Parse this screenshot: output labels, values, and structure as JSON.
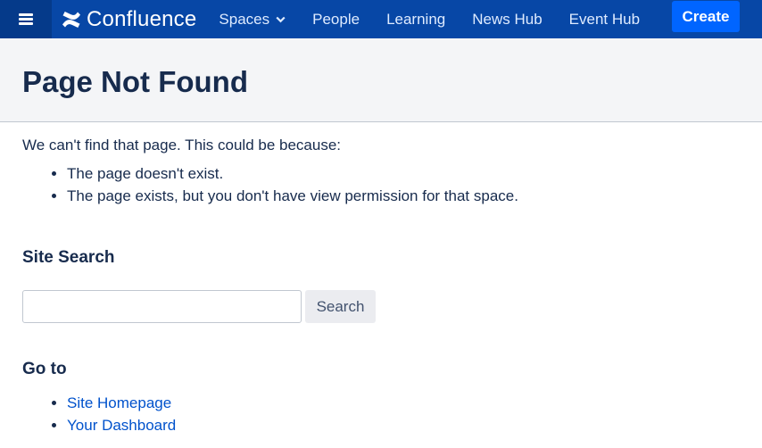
{
  "topbar": {
    "logo_text": "Confluence",
    "nav_items": [
      {
        "label": "Spaces",
        "has_dropdown": true
      },
      {
        "label": "People"
      },
      {
        "label": "Learning"
      },
      {
        "label": "News Hub"
      },
      {
        "label": "Event Hub"
      }
    ],
    "create_label": "Create",
    "colors": {
      "bar": "#0747a6",
      "menu": "#053a8a",
      "create": "#0065ff"
    }
  },
  "page": {
    "title": "Page Not Found",
    "intro": "We can't find that page. This could be because:",
    "reasons": [
      "The page doesn't exist.",
      "The page exists, but you don't have view permission for that space."
    ]
  },
  "search": {
    "title": "Site Search",
    "value": "",
    "placeholder": "",
    "button_label": "Search"
  },
  "goto": {
    "title": "Go to",
    "links": [
      "Site Homepage",
      "Your Dashboard"
    ]
  },
  "icons": {
    "menu": "hamburger-menu-icon",
    "logo": "confluence-logo-icon",
    "dropdown": "chevron-down-icon"
  }
}
